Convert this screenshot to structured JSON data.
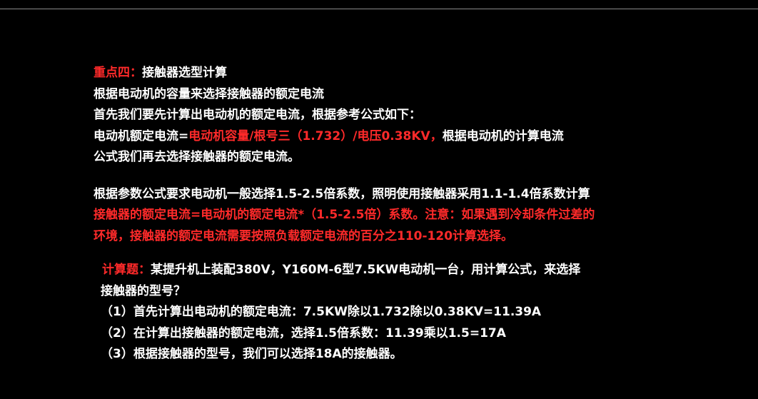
{
  "section1": {
    "title_label": "重点四：",
    "title_text": "接触器选型计算",
    "line1": "根据电动机的容量来选择接触器的额定电流",
    "line2": "首先我们要先计算出电动机的额定电流，根据参考公式如下：",
    "line3_a": "电动机额定电流=",
    "line3_b": "电动机容量/根号三（1.732）/电压0.38KV，",
    "line3_c": "根据电动机的计算电流",
    "line4": "公式我们再去选择接触器的额定电流。"
  },
  "section2": {
    "line1": "根据参数公式要求电动机一般选择1.5-2.5倍系数，照明使用接触器采用1.1-1.4倍系数计算",
    "line2": "接触器的额定电流=电动机的额定电流*（1.5-2.5倍）系数。注意：如果遇到冷却条件过差的",
    "line3": "环境，接触器的额定电流需要按照负载额定电流的百分之110-120计算选择。"
  },
  "section3": {
    "title_label": "计算题：",
    "title_text": "某提升机上装配380V，Y160M-6型7.5KW电动机一台，用计算公式，来选择",
    "title_cont": "接触器的型号？",
    "step1": "（1）首先计算出电动机的额定电流：7.5KW除以1.732除以0.38KV=11.39A",
    "step2": "（2）在计算出接触器的额定电流，选择1.5倍系数：11.39乘以1.5=17A",
    "step3": "（3）根据接触器的型号，我们可以选择18A的接触器。"
  },
  "colors": {
    "background": "#000000",
    "text": "#ffffff",
    "highlight": "#ff2a2a"
  }
}
